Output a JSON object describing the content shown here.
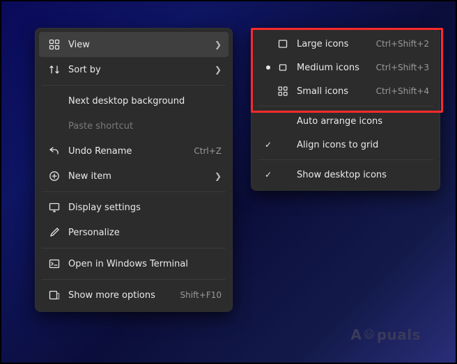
{
  "watermark": {
    "a": "A",
    "puals": "puals"
  },
  "main": {
    "view": {
      "label": "View"
    },
    "sortBy": {
      "label": "Sort by"
    },
    "nextBg": {
      "label": "Next desktop background"
    },
    "pasteShortcut": {
      "label": "Paste shortcut"
    },
    "undoRename": {
      "label": "Undo Rename",
      "accel": "Ctrl+Z"
    },
    "newItem": {
      "label": "New item"
    },
    "displaySettings": {
      "label": "Display settings"
    },
    "personalize": {
      "label": "Personalize"
    },
    "openTerminal": {
      "label": "Open in Windows Terminal"
    },
    "moreOptions": {
      "label": "Show more options",
      "accel": "Shift+F10"
    }
  },
  "sub": {
    "largeIcons": {
      "label": "Large icons",
      "accel": "Ctrl+Shift+2"
    },
    "mediumIcons": {
      "label": "Medium icons",
      "accel": "Ctrl+Shift+3",
      "selected": true
    },
    "smallIcons": {
      "label": "Small icons",
      "accel": "Ctrl+Shift+4"
    },
    "autoArrange": {
      "label": "Auto arrange icons",
      "checked": false
    },
    "alignGrid": {
      "label": "Align icons to grid",
      "checked": true
    },
    "showIcons": {
      "label": "Show desktop icons",
      "checked": true
    }
  }
}
